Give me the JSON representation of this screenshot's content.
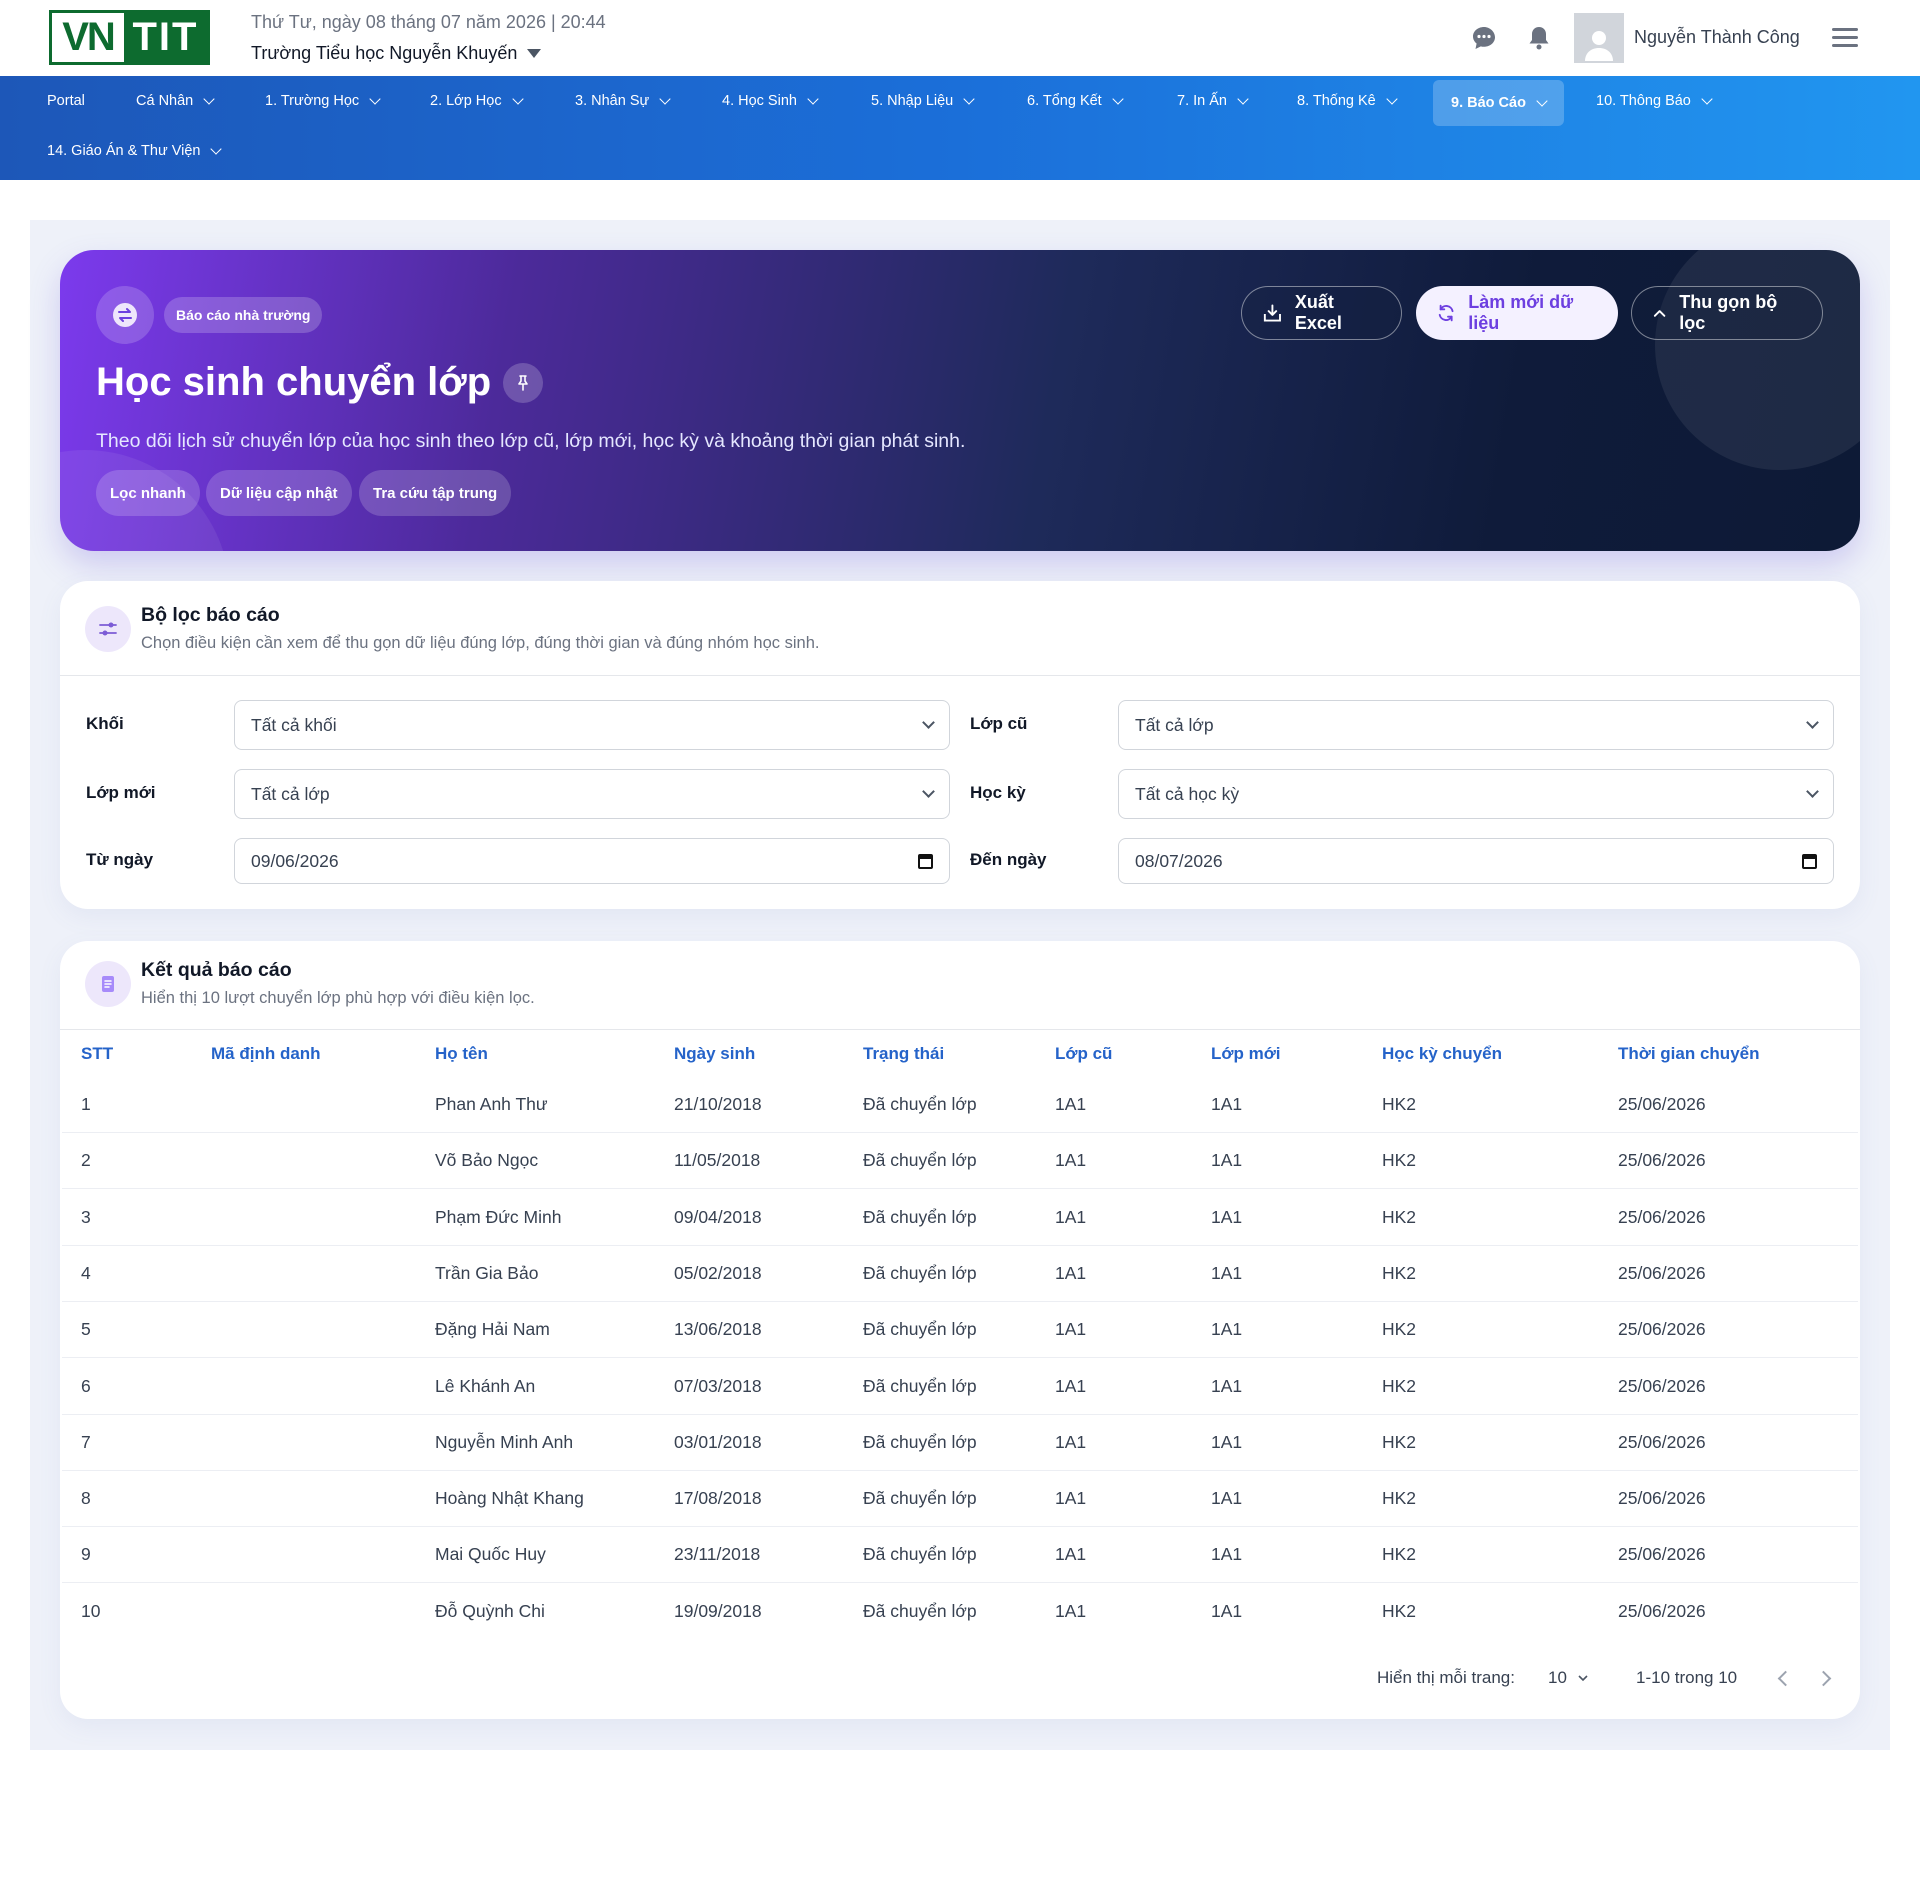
{
  "header": {
    "logo_left": "VN",
    "logo_right": "TIT",
    "date_time": "Thứ Tư, ngày 08 tháng 07 năm 2026 | 20:44",
    "school": "Trường Tiểu học Nguyễn Khuyến",
    "user_name": "Nguyễn Thành Công",
    "icons": [
      "chat-icon",
      "bell-icon",
      "avatar-icon",
      "hamburger-icon"
    ]
  },
  "nav": {
    "items": [
      {
        "label": "Portal"
      },
      {
        "label": "Cá Nhân"
      },
      {
        "label": "1. Trường Học"
      },
      {
        "label": "2. Lớp Học"
      },
      {
        "label": "3. Nhân Sự"
      },
      {
        "label": "4. Học Sinh"
      },
      {
        "label": "5. Nhập Liệu"
      },
      {
        "label": "6. Tổng Kết"
      },
      {
        "label": "7. In Ấn"
      },
      {
        "label": "8. Thống Kê"
      },
      {
        "label": "9. Báo Cáo",
        "active": true
      },
      {
        "label": "10. Thông Báo"
      },
      {
        "label": "14. Giáo Án & Thư Viện"
      }
    ]
  },
  "hero": {
    "badge": "Báo cáo nhà trường",
    "title": "Học sinh chuyển lớp",
    "description": "Theo dõi lịch sử chuyển lớp của học sinh theo lớp cũ, lớp mới, học kỳ và khoảng thời gian phát sinh.",
    "chips": [
      "Lọc nhanh",
      "Dữ liệu cập nhật",
      "Tra cứu tập trung"
    ],
    "buttons": {
      "export": "Xuất Excel",
      "refresh": "Làm mới dữ liệu",
      "collapse": "Thu gọn bộ lọc"
    }
  },
  "filters": {
    "title": "Bộ lọc báo cáo",
    "subtitle": "Chọn điều kiện cần xem để thu gọn dữ liệu đúng lớp, đúng thời gian và đúng nhóm học sinh.",
    "grade_label": "Khối",
    "grade_value": "Tất cả khối",
    "old_class_label": "Lớp cũ",
    "old_class_value": "Tất cả lớp",
    "new_class_label": "Lớp mới",
    "new_class_value": "Tất cả lớp",
    "semester_label": "Học kỳ",
    "semester_value": "Tất cả học kỳ",
    "from_label": "Từ ngày",
    "from_value": "09/06/2026",
    "to_label": "Đến ngày",
    "to_value": "08/07/2026"
  },
  "results": {
    "title": "Kết quả báo cáo",
    "subtitle": "Hiển thị 10 lượt chuyển lớp phù hợp với điều kiện lọc.",
    "columns": [
      "STT",
      "Mã định danh",
      "Họ tên",
      "Ngày sinh",
      "Trạng thái",
      "Lớp cũ",
      "Lớp mới",
      "Học kỳ chuyển",
      "Thời gian chuyển"
    ],
    "rows": [
      [
        "1",
        "",
        "Phan Anh Thư",
        "21/10/2018",
        "Đã chuyển lớp",
        "1A1",
        "1A1",
        "HK2",
        "25/06/2026"
      ],
      [
        "2",
        "",
        "Võ Bảo Ngọc",
        "11/05/2018",
        "Đã chuyển lớp",
        "1A1",
        "1A1",
        "HK2",
        "25/06/2026"
      ],
      [
        "3",
        "",
        "Phạm Đức Minh",
        "09/04/2018",
        "Đã chuyển lớp",
        "1A1",
        "1A1",
        "HK2",
        "25/06/2026"
      ],
      [
        "4",
        "",
        "Trần Gia Bảo",
        "05/02/2018",
        "Đã chuyển lớp",
        "1A1",
        "1A1",
        "HK2",
        "25/06/2026"
      ],
      [
        "5",
        "",
        "Đặng Hải Nam",
        "13/06/2018",
        "Đã chuyển lớp",
        "1A1",
        "1A1",
        "HK2",
        "25/06/2026"
      ],
      [
        "6",
        "",
        "Lê Khánh An",
        "07/03/2018",
        "Đã chuyển lớp",
        "1A1",
        "1A1",
        "HK2",
        "25/06/2026"
      ],
      [
        "7",
        "",
        "Nguyễn Minh Anh",
        "03/01/2018",
        "Đã chuyển lớp",
        "1A1",
        "1A1",
        "HK2",
        "25/06/2026"
      ],
      [
        "8",
        "",
        "Hoàng Nhật Khang",
        "17/08/2018",
        "Đã chuyển lớp",
        "1A1",
        "1A1",
        "HK2",
        "25/06/2026"
      ],
      [
        "9",
        "",
        "Mai Quốc Huy",
        "23/11/2018",
        "Đã chuyển lớp",
        "1A1",
        "1A1",
        "HK2",
        "25/06/2026"
      ],
      [
        "10",
        "",
        "Đỗ Quỳnh Chi",
        "19/09/2018",
        "Đã chuyển lớp",
        "1A1",
        "1A1",
        "HK2",
        "25/06/2026"
      ]
    ],
    "pagination": {
      "per_page_label": "Hiển thị mỗi trang:",
      "per_page_value": "10",
      "range": "1-10 trong 10"
    }
  },
  "colors": {
    "nav_start": "#1d57b8",
    "nav_end": "#2196f0",
    "accent_purple": "#6d3fe0",
    "table_header_blue": "#2563c9",
    "logo_green": "#0d6b2f"
  }
}
